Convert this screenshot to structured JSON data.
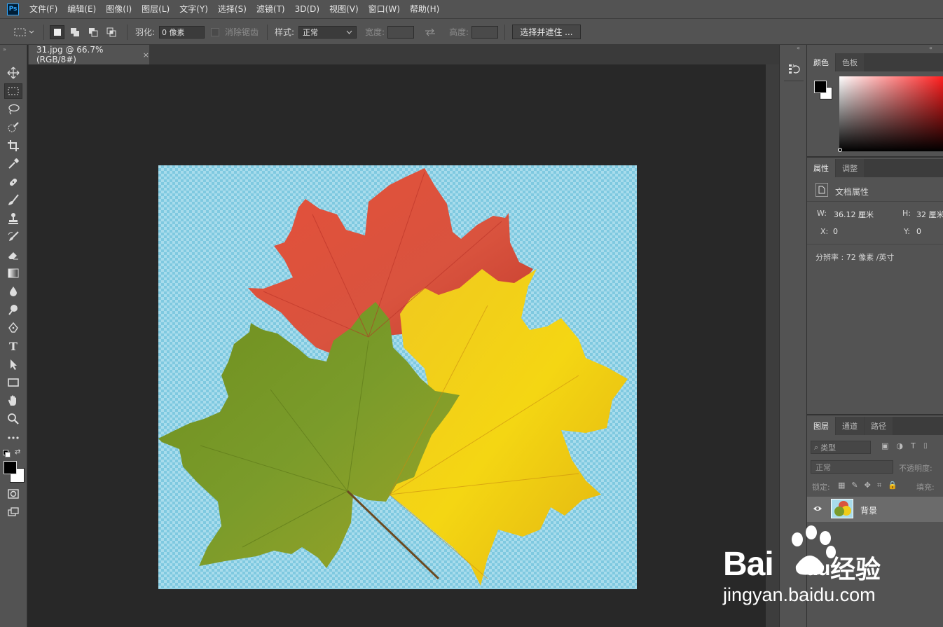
{
  "menu": {
    "logo": "Ps",
    "items": [
      "文件(F)",
      "编辑(E)",
      "图像(I)",
      "图层(L)",
      "文字(Y)",
      "选择(S)",
      "滤镜(T)",
      "3D(D)",
      "视图(V)",
      "窗口(W)",
      "帮助(H)"
    ]
  },
  "options": {
    "feather_label": "羽化:",
    "feather_value": "0 像素",
    "antialias_label": "消除锯齿",
    "style_label": "样式:",
    "style_value": "正常",
    "width_label": "宽度:",
    "height_label": "高度:",
    "select_mask_button": "选择并遮住 ..."
  },
  "document": {
    "tab_title": "31.jpg @ 66.7%(RGB/8#)",
    "close": "×"
  },
  "color_panel": {
    "tabs": [
      "颜色",
      "色板"
    ]
  },
  "properties_panel": {
    "tabs": [
      "属性",
      "调整"
    ],
    "title": "文档属性",
    "w_label": "W:",
    "w_value": "36.12 厘米",
    "h_label": "H:",
    "h_value": "32 厘米",
    "x_label": "X:",
    "x_value": "0",
    "y_label": "Y:",
    "y_value": "0",
    "resolution": "分辨率 : 72 像素 /英寸"
  },
  "layers_panel": {
    "tabs": [
      "图层",
      "通道",
      "路径"
    ],
    "filter_kind": "类型",
    "blend_mode": "正常",
    "opacity_label": "不透明度:",
    "lock_label": "锁定:",
    "fill_label": "填充:",
    "layer_name": "背景"
  },
  "watermark": {
    "brand_latin": "Bai",
    "brand_du": "du",
    "brand_cn": "经验",
    "url": "jingyan.baidu.com"
  },
  "colors": {
    "menubar": "#535353",
    "workspace": "#282828",
    "transparency_light": "#a8dcec",
    "transparency_dark": "#7fc9e0"
  }
}
